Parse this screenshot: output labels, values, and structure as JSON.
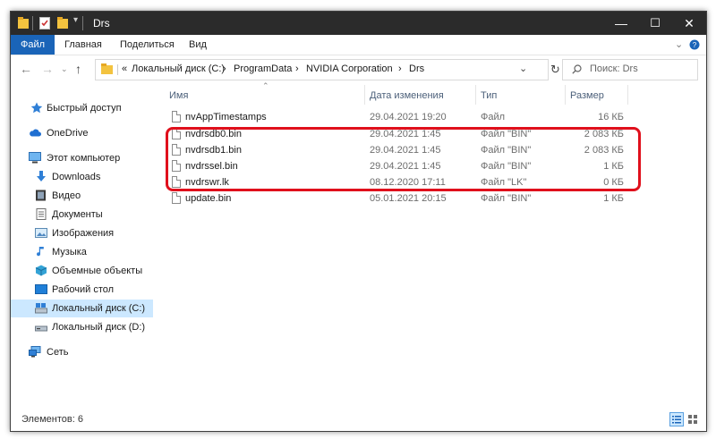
{
  "window": {
    "title": "Drs",
    "controls": {
      "minimize": "—",
      "maximize": "☐",
      "close": "✕"
    }
  },
  "ribbon": {
    "tabs": [
      "Файл",
      "Главная",
      "Поделиться",
      "Вид"
    ],
    "collapse_icon": "chevron-down-icon",
    "help_icon": "help-icon"
  },
  "address": {
    "overflow": "«",
    "crumbs": [
      "Локальный диск (C:)",
      "ProgramData",
      "NVIDIA Corporation",
      "Drs"
    ],
    "separator": "›",
    "search_placeholder": "Поиск: Drs"
  },
  "sidebar": {
    "items": [
      {
        "label": "Быстрый доступ",
        "icon": "star-icon"
      },
      {
        "label": "OneDrive",
        "icon": "cloud-icon"
      },
      {
        "label": "Этот компьютер",
        "icon": "computer-icon"
      },
      {
        "label": "Downloads",
        "icon": "download-icon"
      },
      {
        "label": "Видео",
        "icon": "video-icon"
      },
      {
        "label": "Документы",
        "icon": "documents-icon"
      },
      {
        "label": "Изображения",
        "icon": "pictures-icon"
      },
      {
        "label": "Музыка",
        "icon": "music-icon"
      },
      {
        "label": "Объемные объекты",
        "icon": "3d-objects-icon"
      },
      {
        "label": "Рабочий стол",
        "icon": "desktop-icon"
      },
      {
        "label": "Локальный диск (C:)",
        "icon": "drive-c-icon",
        "selected": true
      },
      {
        "label": "Локальный диск (D:)",
        "icon": "drive-icon"
      },
      {
        "label": "Сеть",
        "icon": "network-icon"
      }
    ]
  },
  "columns": {
    "name": "Имя",
    "date": "Дата изменения",
    "type": "Тип",
    "size": "Размер"
  },
  "files": [
    {
      "name": "nvAppTimestamps",
      "date": "29.04.2021 19:20",
      "type": "Файл",
      "size": "16 КБ"
    },
    {
      "name": "nvdrsdb0.bin",
      "date": "29.04.2021 1:45",
      "type": "Файл \"BIN\"",
      "size": "2 083 КБ"
    },
    {
      "name": "nvdrsdb1.bin",
      "date": "29.04.2021 1:45",
      "type": "Файл \"BIN\"",
      "size": "2 083 КБ"
    },
    {
      "name": "nvdrssel.bin",
      "date": "29.04.2021 1:45",
      "type": "Файл \"BIN\"",
      "size": "1 КБ"
    },
    {
      "name": "nvdrswr.lk",
      "date": "08.12.2020 17:11",
      "type": "Файл \"LK\"",
      "size": "0 КБ"
    },
    {
      "name": "update.bin",
      "date": "05.01.2021 20:15",
      "type": "Файл \"BIN\"",
      "size": "1 КБ"
    }
  ],
  "status": {
    "text": "Элементов: 6"
  },
  "colors": {
    "accent": "#1a64b8",
    "highlight": "#e0101c",
    "selection": "#cce8ff",
    "titlebar": "#2b2b2b"
  }
}
